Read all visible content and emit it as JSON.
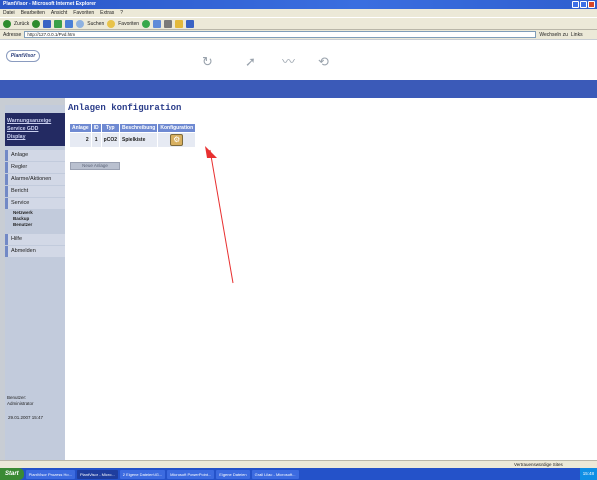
{
  "window": {
    "title": "PlantVisor - Microsoft Internet Explorer"
  },
  "menubar": [
    "Datei",
    "Bearbeiten",
    "Ansicht",
    "Favoriten",
    "Extras",
    "?"
  ],
  "toolbar": {
    "back_label": "Zurück",
    "search_label": "Suchen",
    "favorites_label": "Favoriten"
  },
  "addressbar": {
    "label": "Adresse",
    "url": "http://127.0.0.1/Pvd.htm",
    "go_label": "Wechseln zu",
    "links_label": "Links"
  },
  "app": {
    "logo_text": "PlantVisor"
  },
  "sidebar": {
    "quicklinks": [
      "Warnungsanzeige",
      "Service GDD",
      "Display"
    ],
    "nav": [
      "Anlage",
      "Regler",
      "Alarme/Aktionen",
      "Bericht",
      "Service"
    ],
    "service_sub": [
      "Netzwerk",
      "Backup",
      "Benutzer"
    ],
    "nav_bottom": [
      "Hilfe",
      "Abmelden"
    ],
    "user_label": "Benutzer:",
    "user_name": "Administrator",
    "datetime": "29.01.2007 15:47"
  },
  "main": {
    "title": "Anlagen konfiguration",
    "table": {
      "headers": [
        "Anlage",
        "ID",
        "Typ",
        "Beschreibung",
        "Konfiguration"
      ],
      "rows": [
        {
          "anlage": "2",
          "id": "1",
          "typ": "pCO2",
          "beschreibung": "Spielkiste"
        }
      ]
    },
    "new_button": "Neue Anlage"
  },
  "statusbar": {
    "zone": "Vertrauenswürdige Sites"
  },
  "taskbar": {
    "start": "Start",
    "tasks": [
      "PlantVisor Prozess Ho...",
      "PlantVisor - Micro...",
      "2 Eigene Dateien\\IG...",
      "Microsoft PowerPoint...",
      "Eigene Dateien",
      "Grall Lilac - Microsoft..."
    ],
    "clock": "15:48"
  }
}
